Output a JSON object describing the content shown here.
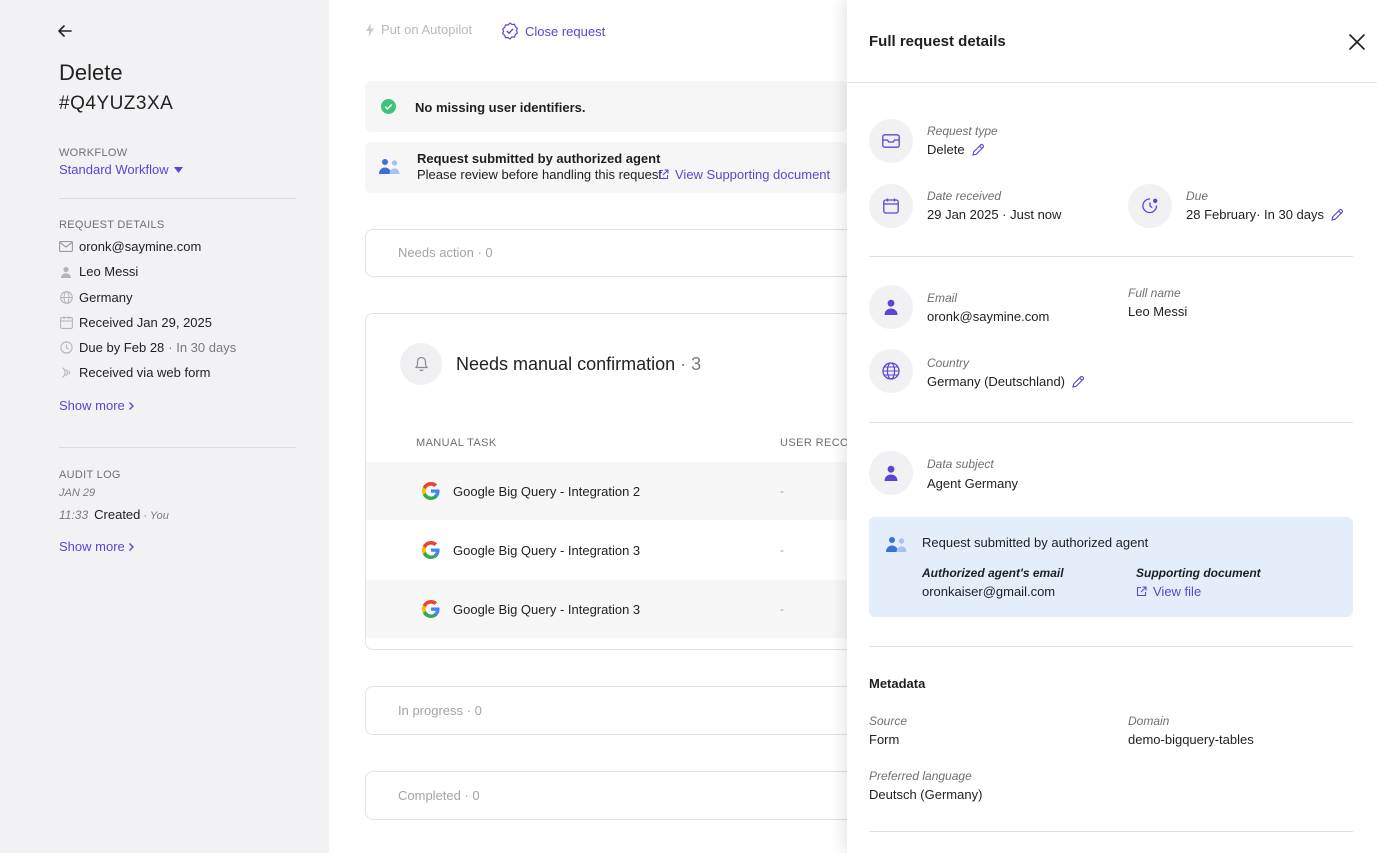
{
  "sidebar": {
    "title": "Delete",
    "request_id": "#Q4YUZ3XA",
    "workflow_label": "WORKFLOW",
    "workflow_value": "Standard Workflow",
    "request_details_label": "REQUEST DETAILS",
    "email": "oronk@saymine.com",
    "name": "Leo Messi",
    "country": "Germany",
    "received": "Received Jan 29, 2025",
    "due": "Due by Feb 28",
    "due_relative": "· In 30 days",
    "via": "Received via web form",
    "show_more": "Show more",
    "audit_log_label": "AUDIT LOG",
    "audit_date": "JAN 29",
    "audit_time": "11:33",
    "audit_action": "Created",
    "audit_actor": "· You",
    "show_more_audit": "Show more"
  },
  "toolbar": {
    "autopilot": "Put on Autopilot",
    "close_request": "Close request"
  },
  "banners": {
    "identifiers": "No missing user identifiers.",
    "agent_title": "Request submitted by authorized agent",
    "agent_sub": "Please review before handling this request.",
    "agent_link": "View Supporting document"
  },
  "sections": {
    "needs_action": "Needs action · 0",
    "manual_title": "Needs manual confirmation",
    "manual_count": "· 3",
    "col_task": "MANUAL TASK",
    "col_user": "USER RECOR",
    "tasks": [
      {
        "name": "Google Big Query - Integration 2",
        "value": "-"
      },
      {
        "name": "Google Big Query - Integration 3",
        "value": "-"
      },
      {
        "name": "Google Big Query - Integration 3",
        "value": "-"
      }
    ],
    "in_progress": "In progress · 0",
    "completed": "Completed · 0"
  },
  "drawer": {
    "title": "Full request details",
    "request_type_label": "Request type",
    "request_type_value": "Delete",
    "date_received_label": "Date received",
    "date_received_value": "29 Jan 2025 · Just now",
    "due_label": "Due",
    "due_value": "28 February· In 30 days",
    "email_label": "Email",
    "email_value": "oronk@saymine.com",
    "fullname_label": "Full name",
    "fullname_value": "Leo Messi",
    "country_label": "Country",
    "country_value": "Germany (Deutschland)",
    "subject_label": "Data subject",
    "subject_value": "Agent Germany",
    "agent_box_title": "Request submitted by authorized agent",
    "agent_email_label": "Authorized agent's email",
    "agent_email_value": "oronkaiser@gmail.com",
    "supporting_label": "Supporting document",
    "supporting_link": "View file",
    "metadata_title": "Metadata",
    "source_label": "Source",
    "source_value": "Form",
    "domain_label": "Domain",
    "domain_value": "demo-bigquery-tables",
    "language_label": "Preferred language",
    "language_value": "Deutsch (Germany)"
  },
  "colors": {
    "accent": "#5b45d6",
    "success": "#3cc47c",
    "sidebar_bg": "#f2f2f4",
    "agent_box_bg": "#e4eefb"
  }
}
